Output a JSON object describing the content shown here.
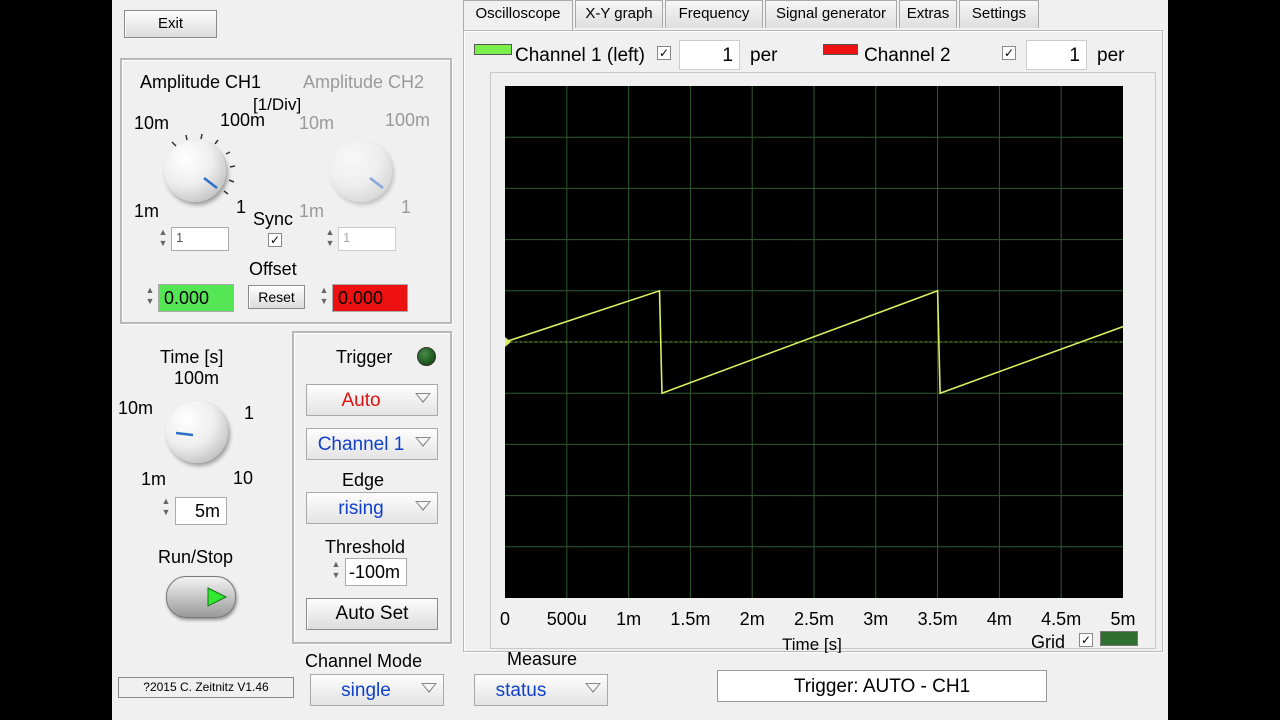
{
  "buttons": {
    "exit": "Exit",
    "reset": "Reset",
    "auto_set": "Auto Set"
  },
  "tabs": [
    "Oscilloscope",
    "X-Y graph",
    "Frequency",
    "Signal generator",
    "Extras",
    "Settings"
  ],
  "amplitude": {
    "ch1_title": "Amplitude CH1",
    "ch2_title": "Amplitude CH2",
    "unit": "[1/Div]",
    "ch1_scale": [
      "10m",
      "100m",
      "1m",
      "1"
    ],
    "ch2_scale": [
      "10m",
      "100m",
      "1m",
      "1"
    ],
    "ch1_value": "1",
    "ch2_value": "1",
    "sync_label": "Sync",
    "sync_checked": "✓",
    "offset_label": "Offset",
    "offset_ch1": "0.000",
    "offset_ch2": "0.000"
  },
  "time": {
    "title": "Time [s]",
    "scale": [
      "100m",
      "10m",
      "1",
      "1m",
      "10"
    ],
    "value": "5m"
  },
  "run_stop": {
    "label": "Run/Stop"
  },
  "trigger": {
    "title": "Trigger",
    "mode": "Auto",
    "source": "Channel 1",
    "edge_label": "Edge",
    "edge": "rising",
    "threshold_label": "Threshold",
    "threshold": "-100m"
  },
  "channel_mode": {
    "label": "Channel Mode",
    "value": "single"
  },
  "footer": {
    "version": "?2015  C. Zeitnitz V1.46"
  },
  "channels": {
    "ch1_label": "Channel 1 (left)",
    "ch1_per": "1",
    "ch2_label": "Channel 2",
    "ch2_per": "1",
    "per_label": "per",
    "check": "✓"
  },
  "measure": {
    "label": "Measure",
    "value": "status"
  },
  "status_text": "Trigger: AUTO - CH1",
  "grid": {
    "label": "Grid",
    "check": "✓"
  },
  "colors": {
    "ch1": "#7cf04a",
    "ch2": "#ee1111",
    "trace": "#d8f060",
    "grid_lines": "#2f5a2f",
    "trigger_led": "#1f5a1f"
  },
  "chart_data": {
    "type": "line",
    "xlabel": "Time [s]",
    "x_tick_labels": [
      "0",
      "500u",
      "1m",
      "1.5m",
      "2m",
      "2.5m",
      "3m",
      "3.5m",
      "4m",
      "4.5m",
      "5m"
    ],
    "xlim": [
      0,
      0.005
    ],
    "ylim": [
      -5,
      5
    ],
    "grid": true,
    "series": [
      {
        "name": "Channel 1 (left)",
        "x": [
          0,
          0.00125,
          0.00127,
          0.0035,
          0.00352,
          0.005
        ],
        "y": [
          0,
          1,
          -1,
          1,
          -1,
          0.3
        ]
      }
    ]
  }
}
